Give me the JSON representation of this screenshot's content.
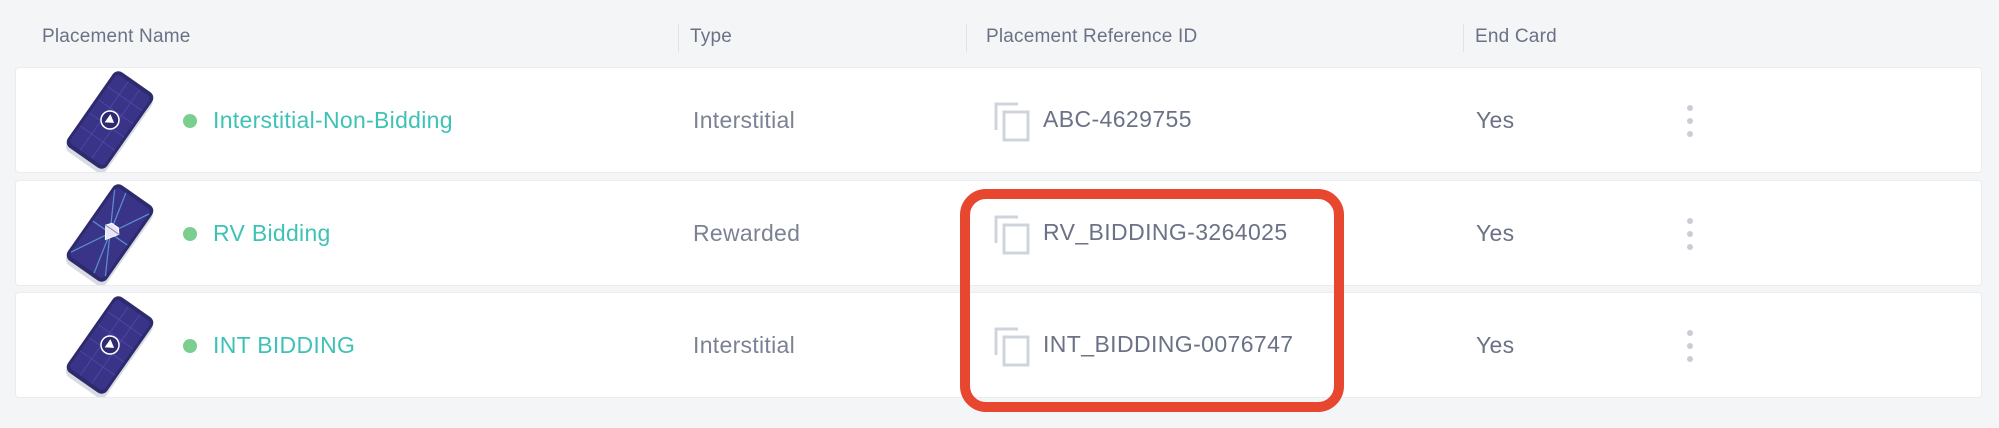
{
  "header": {
    "placement_name": "Placement Name",
    "type": "Type",
    "reference_id": "Placement Reference ID",
    "end_card": "End Card"
  },
  "rows": [
    {
      "name": "Interstitial-Non-Bidding",
      "type": "Interstitial",
      "reference_id": "ABC-4629755",
      "end_card": "Yes",
      "status": "active",
      "thumbnail": "phone-play-icon"
    },
    {
      "name": "RV Bidding",
      "type": "Rewarded",
      "reference_id": "RV_BIDDING-3264025",
      "end_card": "Yes",
      "status": "active",
      "thumbnail": "phone-gem-icon"
    },
    {
      "name": "INT BIDDING",
      "type": "Interstitial",
      "reference_id": "INT_BIDDING-0076747",
      "end_card": "Yes",
      "status": "active",
      "thumbnail": "phone-play-icon"
    }
  ],
  "colors": {
    "name_link": "#3fc2b6",
    "status_active": "#7bcf8e",
    "highlight": "#e8472f",
    "phone_screen": "#2e2a6e"
  }
}
